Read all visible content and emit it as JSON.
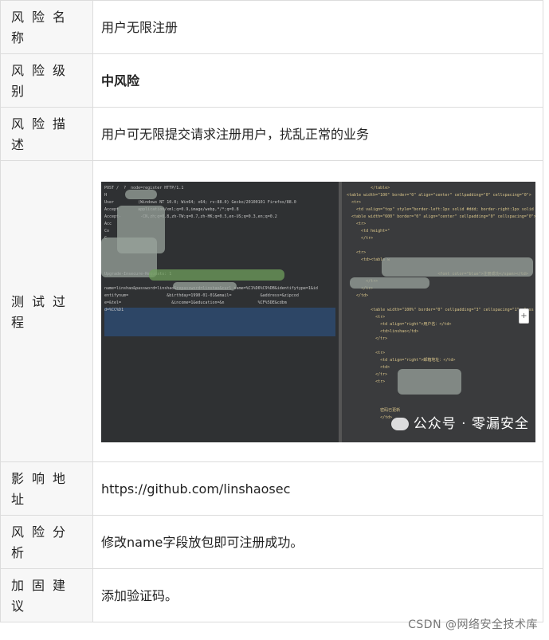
{
  "rows": [
    {
      "label": "风险名称",
      "value": "用户无限注册"
    },
    {
      "label": "风险级别",
      "value": "中风险"
    },
    {
      "label": "风险描述",
      "value": "用户可无限提交请求注册用户，扰乱正常的业务"
    },
    {
      "label": "测试过程"
    },
    {
      "label": "影响地址",
      "value": "https://github.com/linshaosec"
    },
    {
      "label": "风险分析",
      "value": "修改name字段放包即可注册成功。"
    },
    {
      "label": "加固建议",
      "value": "添加验证码。"
    }
  ],
  "screenshot": {
    "left_code": "POST /  ?  node=register HTTP/1.1\nH\nUser          (Windows NT 10.0; Win64; x64; rv:88.0) Gecko/20100101 Firefox/88.0\nAccept        application/xml;q=0.9,image/webp,*/*;q=0.8\nAccept-        -CN,zh;q=0.8,zh-TW;q=0.7,zh-HK;q=0.5,en-US;q=0.3,en;q=0.2\nAcc\nCo\nC\n\n\n\n\nUpgrade-Insecure-Requests: 1\n\nname=linshao&password=linshao&repassword=linshao&curl_name=%C1%D6%C9%DB&identifytype=1&id\nentifynum=                &birthday=1990-01-01&email=            &address=&zipcod\ne=&tel=                     &income=1&education=&n              %CF%5DE&cdbm\nd=%CC%D1",
    "right_code": "          </table>\n<table width=\"100\" border=\"0\" align=\"center\" cellpadding=\"0\" cellspacing=\"0\">\n  <tr>\n    <td valign=\"top\" style=\"border-left:1px solid #ddd; border-right:1px solid #ddd; border-\n  <table width=\"600\" border=\"0\" align=\"center\" cellpadding=\"0\" cellspacing=\"0\">\n    <tr>\n      <td height=\"\n      </tr>\n\n    <tr>\n      <td><table w\n\n                                      <font color=\"blue\">注册成功</span></td>\n        </tr>\n      </tr>\n    </td>\n\n          <table width=\"100%\" border=\"0\" cellpadding=\"3\" cellspacing=\"1\" class\n            <tr>\n              <td align=\"right\">用户名：</td>\n              <td>linshao</td>\n            </tr>\n\n            <tr>\n              <td align=\"right\">邮箱地址：</td>\n              <td>\n            </tr>\n            <tr>\n\n\n\n              密码已更新\n              </td>",
    "watermark": "公众号 · 零漏安全"
  },
  "footer_watermark": "CSDN @网络安全技术库",
  "side_button": "+"
}
